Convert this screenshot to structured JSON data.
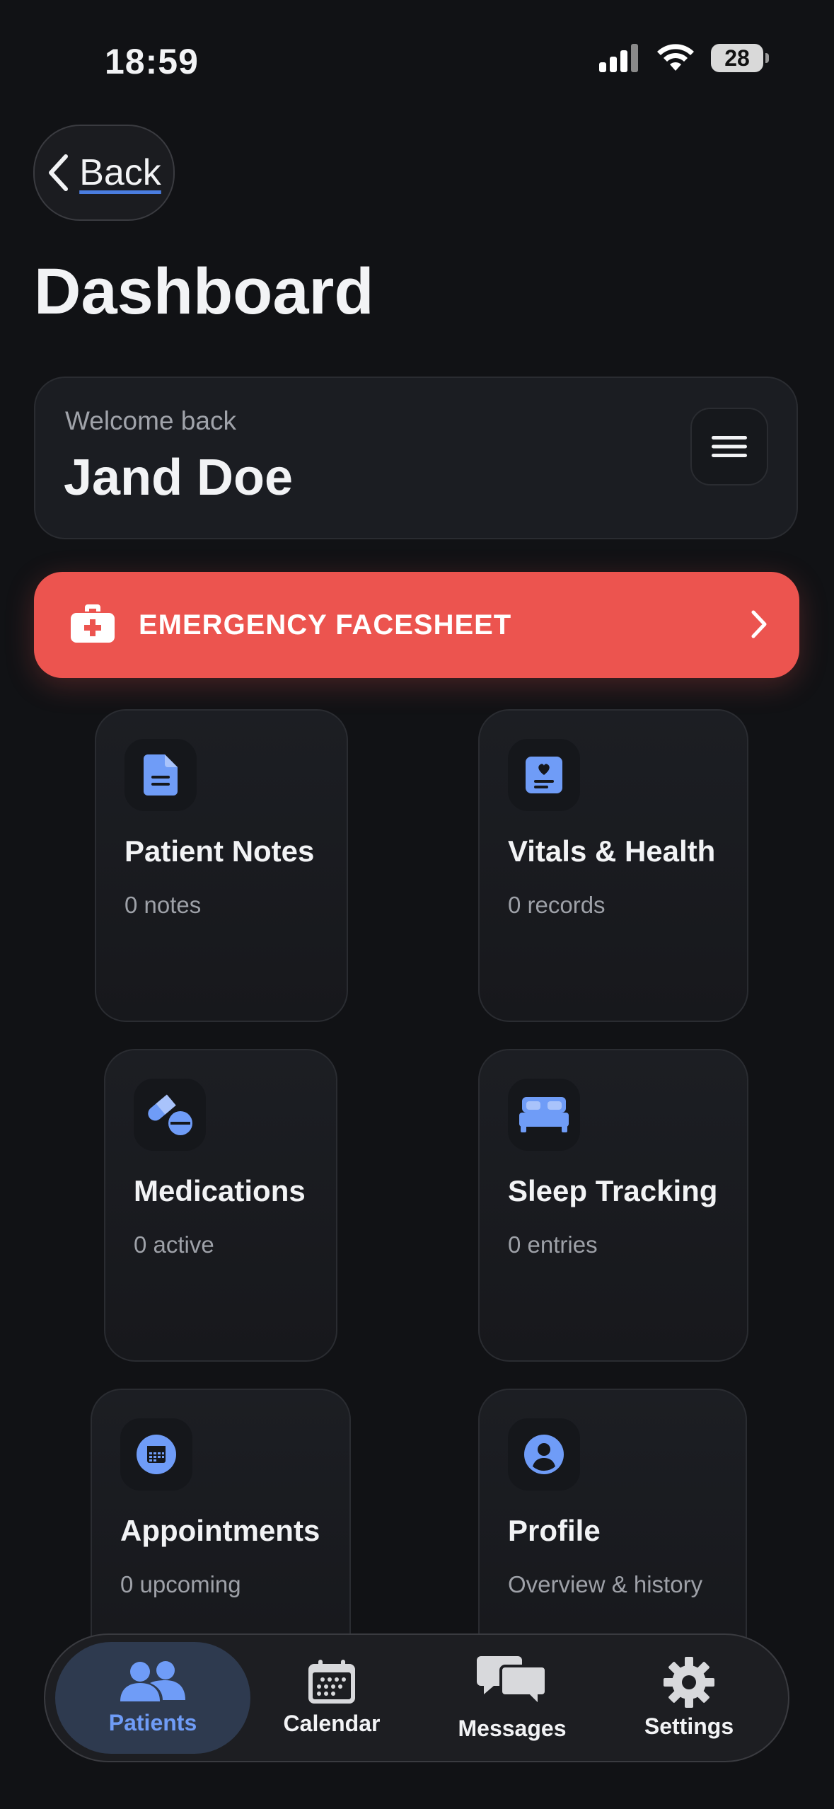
{
  "status_bar": {
    "time": "18:59",
    "battery": "28"
  },
  "nav": {
    "back_label": "Back"
  },
  "header": {
    "title": "Dashboard"
  },
  "welcome": {
    "subtitle": "Welcome back",
    "name": "Jand Doe"
  },
  "emergency": {
    "label": "EMERGENCY FACESHEET",
    "color": "#ec544f"
  },
  "tiles": [
    {
      "title": "Patient Notes",
      "subtitle": "0 notes",
      "icon": "document-icon"
    },
    {
      "title": "Vitals & Health",
      "subtitle": "0 records",
      "icon": "health-record-icon"
    },
    {
      "title": "Medications",
      "subtitle": "0 active",
      "icon": "pills-icon"
    },
    {
      "title": "Sleep Tracking",
      "subtitle": "0 entries",
      "icon": "bed-icon"
    },
    {
      "title": "Appointments",
      "subtitle": "0 upcoming",
      "icon": "calendar-icon"
    },
    {
      "title": "Profile",
      "subtitle": "Overview & history",
      "icon": "user-circle-icon"
    }
  ],
  "tabbar": {
    "items": [
      {
        "label": "Patients",
        "icon": "patients-icon",
        "active": true
      },
      {
        "label": "Calendar",
        "icon": "calendar-icon",
        "active": false
      },
      {
        "label": "Messages",
        "icon": "messages-icon",
        "active": false
      },
      {
        "label": "Settings",
        "icon": "gear-icon",
        "active": false
      }
    ]
  },
  "colors": {
    "accent": "#6f9cf7",
    "background": "#111215",
    "card": "#1b1d22"
  }
}
